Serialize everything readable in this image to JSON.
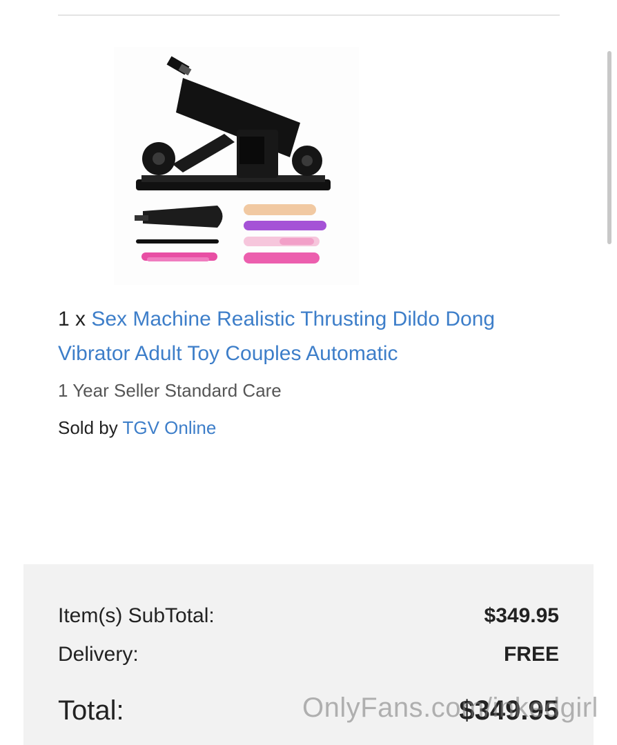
{
  "product": {
    "quantity_prefix": "1 x ",
    "title_line1": "Sex Machine Realistic Thrusting Dildo Dong",
    "title_line2": "Vibrator Adult Toy Couples Automatic",
    "care_plan": "1 Year Seller Standard Care",
    "sold_by_label": "Sold by ",
    "seller_name": "TGV Online",
    "link_color": "#3d7ec9"
  },
  "summary": {
    "subtotal_label": "Item(s) SubTotal:",
    "subtotal_value": "$349.95",
    "delivery_label": "Delivery:",
    "delivery_value": "FREE",
    "total_label": "Total:",
    "total_value": "$349.95",
    "background": "#f2f2f2"
  },
  "watermark": {
    "text": "OnlyFans.com/inkedgirl"
  }
}
